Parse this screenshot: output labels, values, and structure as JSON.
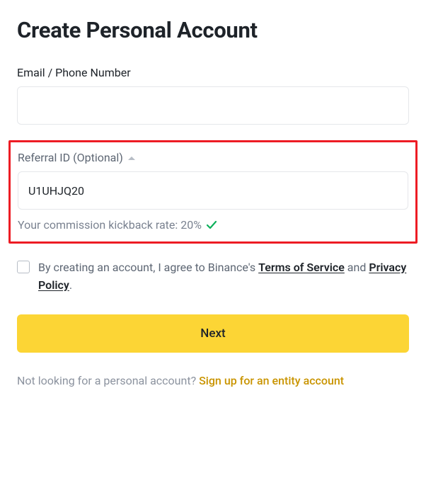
{
  "title": "Create Personal Account",
  "email_phone": {
    "label": "Email / Phone Number",
    "value": ""
  },
  "referral": {
    "label": "Referral ID (Optional)",
    "value": "U1UHJQ20",
    "kickback_text": "Your commission kickback rate: 20%"
  },
  "consent": {
    "prefix": "By creating an account, I agree to Binance's ",
    "terms_label": "Terms of Service",
    "connector": " and ",
    "privacy_label": "Privacy Policy",
    "suffix": "."
  },
  "next_button": "Next",
  "footer": {
    "prompt": "Not looking for a personal account? ",
    "link": "Sign up for an entity account"
  },
  "colors": {
    "accent": "#fcd535",
    "highlight_border": "#ed1c24",
    "success": "#0db05b",
    "link_amber": "#c99400"
  }
}
